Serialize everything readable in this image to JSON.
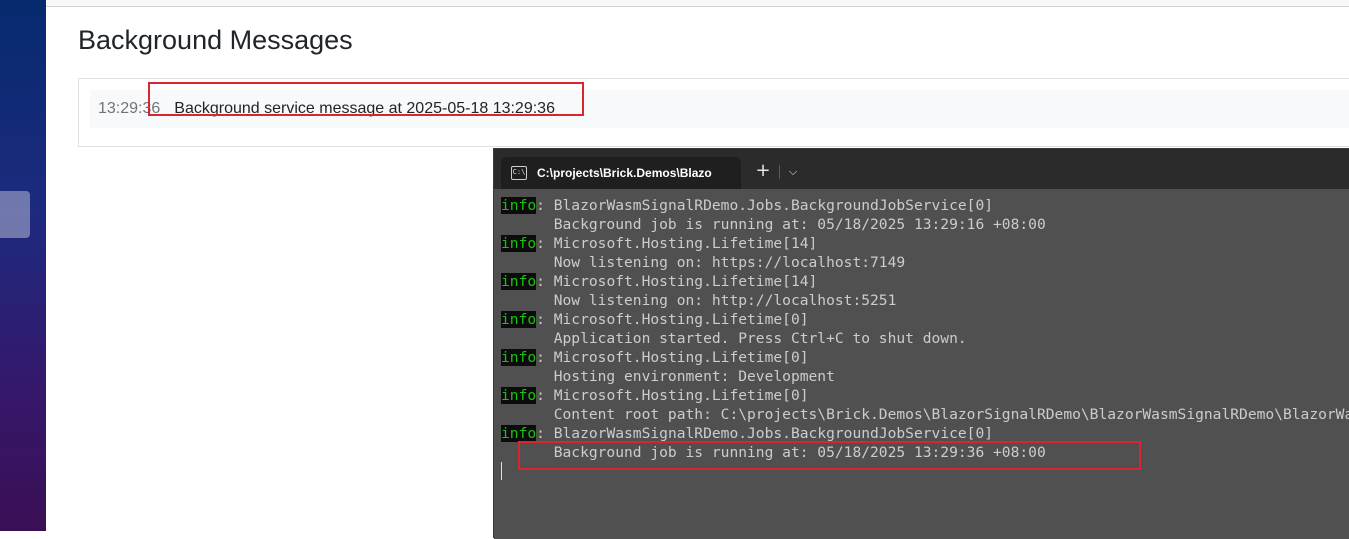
{
  "page": {
    "title": "Background Messages",
    "messages": [
      {
        "time": "13:29:36",
        "text": "Background service message at 2025-05-18 13:29:36"
      }
    ]
  },
  "terminal": {
    "tab_title": "C:\\projects\\Brick.Demos\\Blazo",
    "tab_icon": "terminal-icon",
    "new_tab": "+",
    "dropdown": "⌵",
    "lines": [
      {
        "level": "info",
        "text": ": BlazorWasmSignalRDemo.Jobs.BackgroundJobService[0]"
      },
      {
        "level": "",
        "text": "      Background job is running at: 05/18/2025 13:29:16 +08:00"
      },
      {
        "level": "info",
        "text": ": Microsoft.Hosting.Lifetime[14]"
      },
      {
        "level": "",
        "text": "      Now listening on: https://localhost:7149"
      },
      {
        "level": "info",
        "text": ": Microsoft.Hosting.Lifetime[14]"
      },
      {
        "level": "",
        "text": "      Now listening on: http://localhost:5251"
      },
      {
        "level": "info",
        "text": ": Microsoft.Hosting.Lifetime[0]"
      },
      {
        "level": "",
        "text": "      Application started. Press Ctrl+C to shut down."
      },
      {
        "level": "info",
        "text": ": Microsoft.Hosting.Lifetime[0]"
      },
      {
        "level": "",
        "text": "      Hosting environment: Development"
      },
      {
        "level": "info",
        "text": ": Microsoft.Hosting.Lifetime[0]"
      },
      {
        "level": "",
        "text": "      Content root path: C:\\projects\\Brick.Demos\\BlazorSignalRDemo\\BlazorWasmSignalRDemo\\BlazorWasmSignalRDemo"
      },
      {
        "level": "info",
        "text": ": BlazorWasmSignalRDemo.Jobs.BackgroundJobService[0]"
      },
      {
        "level": "",
        "text": "      Background job is running at: 05/18/2025 13:29:36 +08:00"
      }
    ]
  },
  "colors": {
    "highlight": "#d9262e",
    "info_level": "#16c60c"
  }
}
